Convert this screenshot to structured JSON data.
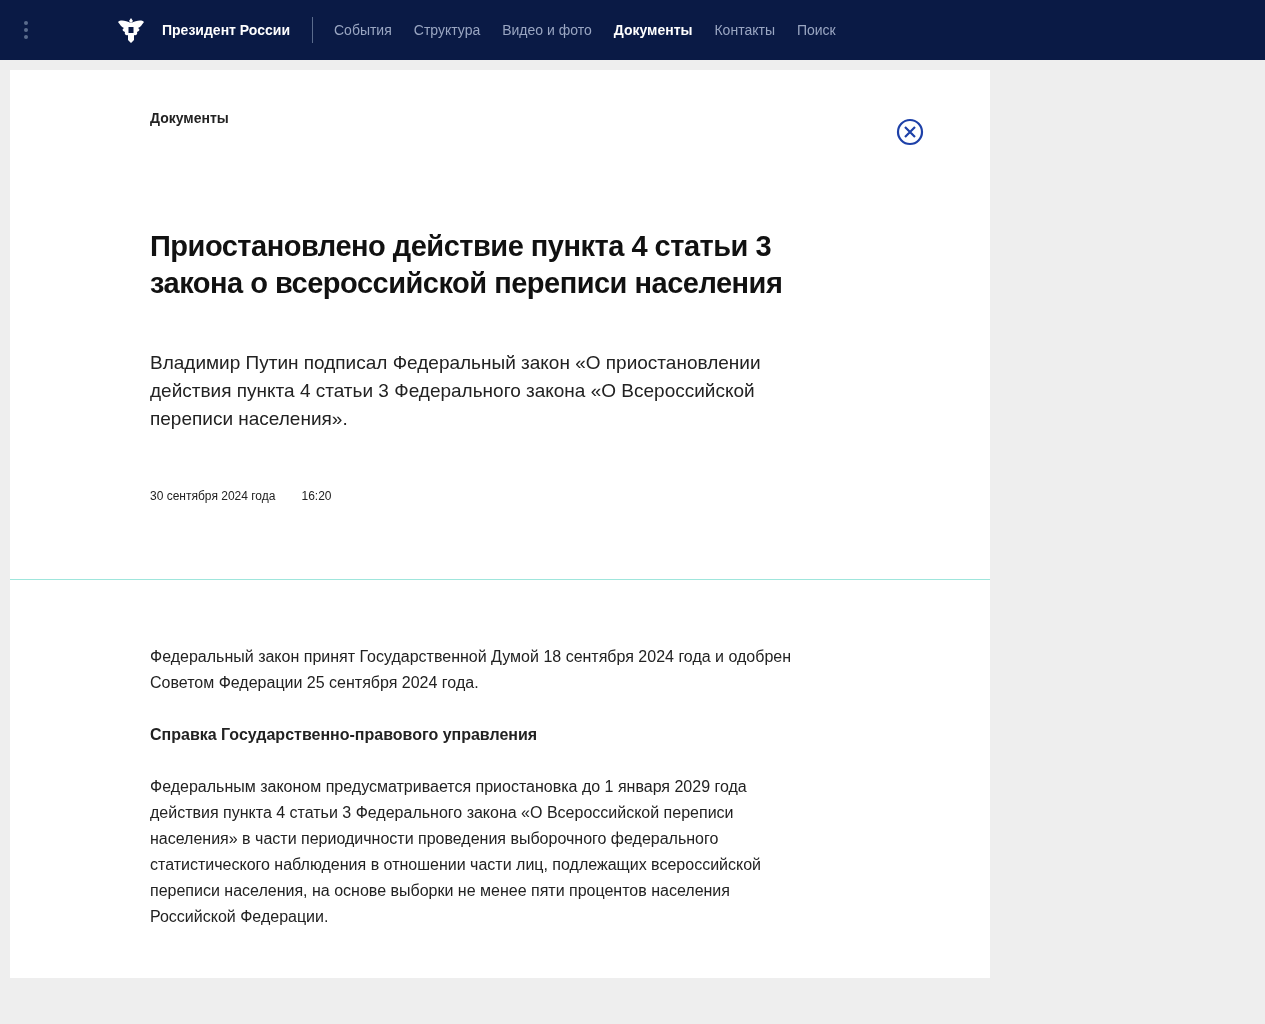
{
  "header": {
    "site_title": "Президент России",
    "nav": [
      {
        "label": "События",
        "selected": false
      },
      {
        "label": "Структура",
        "selected": false
      },
      {
        "label": "Видео и фото",
        "selected": false
      },
      {
        "label": "Документы",
        "selected": true
      },
      {
        "label": "Контакты",
        "selected": false
      },
      {
        "label": "Поиск",
        "selected": false
      }
    ]
  },
  "article": {
    "section": "Документы",
    "title": "Приостановлено действие пункта 4 статьи 3 закона о всероссийской переписи населения",
    "lead": "Владимир Путин подписал Федеральный закон «О приостановлении действия пункта 4 статьи 3 Федерального закона «О Всероссийской переписи населения».",
    "date": "30 сентября 2024 года",
    "time": "16:20",
    "body": [
      {
        "kind": "paragraph",
        "text": "Федеральный закон принят Государственной Думой 18 сентября 2024 года и одобрен Советом Федерации 25 сентября 2024 года."
      },
      {
        "kind": "heading",
        "text": "Справка Государственно-правового управления"
      },
      {
        "kind": "paragraph",
        "text": "Федеральным законом предусматривается приостановка до 1 января 2029 года действия пункта 4 статьи 3 Федерального закона «О Всероссийской переписи населения» в части периодичности проведения выборочного федерального статистического наблюдения в отношении части лиц, подлежащих всероссийской переписи населения, на основе выборки не менее пяти процентов населения Российской Федерации."
      }
    ]
  }
}
